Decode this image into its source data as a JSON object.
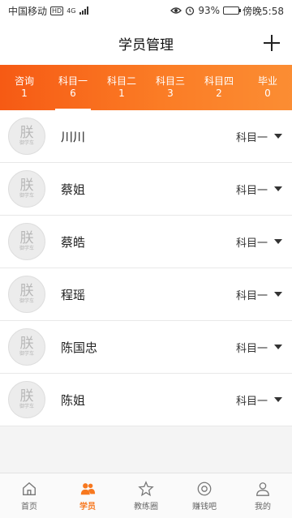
{
  "status_bar": {
    "carrier": "中国移动",
    "hd": "HD",
    "network": "4G",
    "battery_percent": "93%",
    "battery_level": 0.93,
    "time": "傍晚5:58"
  },
  "header": {
    "title": "学员管理",
    "add_icon": "plus-icon"
  },
  "tabs": [
    {
      "label": "咨询",
      "count": "1"
    },
    {
      "label": "科目一",
      "count": "6"
    },
    {
      "label": "科目二",
      "count": "1"
    },
    {
      "label": "科目三",
      "count": "3"
    },
    {
      "label": "科目四",
      "count": "2"
    },
    {
      "label": "毕业",
      "count": "0"
    }
  ],
  "active_tab": 1,
  "colors": {
    "accent": "#f7781f",
    "tab_gradient_start": "#f65a14",
    "tab_gradient_end": "#fb8d33"
  },
  "students": [
    {
      "name": "川川",
      "subject": "科目一",
      "avatar_glyph": "朕",
      "avatar_caption": "御学车"
    },
    {
      "name": "蔡姐",
      "subject": "科目一",
      "avatar_glyph": "朕",
      "avatar_caption": "御学车"
    },
    {
      "name": "蔡皓",
      "subject": "科目一",
      "avatar_glyph": "朕",
      "avatar_caption": "御学车"
    },
    {
      "name": "程瑶",
      "subject": "科目一",
      "avatar_glyph": "朕",
      "avatar_caption": "御学车"
    },
    {
      "name": "陈国忠",
      "subject": "科目一",
      "avatar_glyph": "朕",
      "avatar_caption": "御学车"
    },
    {
      "name": "陈姐",
      "subject": "科目一",
      "avatar_glyph": "朕",
      "avatar_caption": "御学车"
    }
  ],
  "bottom_nav": [
    {
      "label": "首页",
      "icon": "home-icon"
    },
    {
      "label": "学员",
      "icon": "students-icon"
    },
    {
      "label": "教练圈",
      "icon": "coach-circle-icon"
    },
    {
      "label": "赚钱吧",
      "icon": "earn-icon"
    },
    {
      "label": "我的",
      "icon": "profile-icon"
    }
  ],
  "bottom_nav_active": 1
}
